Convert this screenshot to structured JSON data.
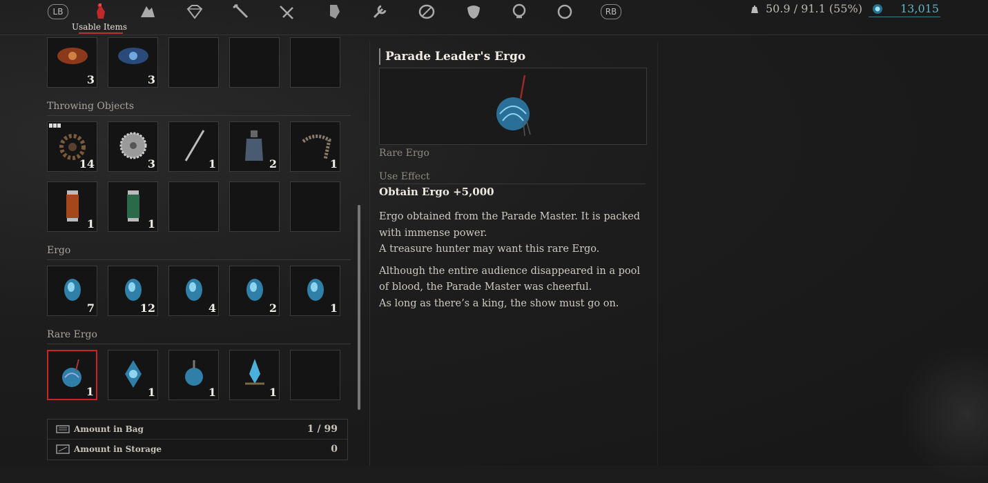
{
  "topbar": {
    "lb": "LB",
    "rb": "RB",
    "tabs": [
      "usable-items-icon",
      "crafting-icon",
      "gem-icon",
      "dagger-icon",
      "sword-icon",
      "gauntlet-icon",
      "wrench-icon",
      "shield-icon",
      "mask-icon",
      "head-icon",
      "ring-icon"
    ],
    "active_tab_label": "Usable Items",
    "weight": "50.9 / 91.1 (55%)",
    "ergo": "13,015"
  },
  "inventory": {
    "top_row_quantities": [
      "3",
      "3"
    ],
    "sections": [
      {
        "title": "Throwing Objects",
        "rows": [
          [
            "14",
            "3",
            "1",
            "2",
            "1"
          ],
          [
            "1",
            "1"
          ]
        ]
      },
      {
        "title": "Ergo",
        "rows": [
          [
            "7",
            "12",
            "4",
            "2",
            "1"
          ]
        ]
      },
      {
        "title": "Rare Ergo",
        "rows": [
          [
            "1",
            "1",
            "1",
            "1"
          ]
        ]
      }
    ],
    "amount_in_bag_label": "Amount in Bag",
    "amount_in_bag": "1 / 99",
    "amount_in_storage_label": "Amount in Storage",
    "amount_in_storage": "0"
  },
  "detail": {
    "title": "Parade Leader's Ergo",
    "rarity": "Rare Ergo",
    "use_effect_label": "Use Effect",
    "use_effect": "Obtain Ergo +5,000",
    "desc_p1_line1": "Ergo obtained from the Parade Master. It is packed with immense power.",
    "desc_p1_line2": "A treasure hunter may want this rare Ergo.",
    "desc_p2_line1": "Although the entire audience disappeared in a pool of blood, the Parade Master was cheerful.",
    "desc_p2_line2": "As long as there’s a king, the show must go on."
  },
  "colors": {
    "accent": "#cc2222",
    "ergo": "#5fb7c6"
  }
}
